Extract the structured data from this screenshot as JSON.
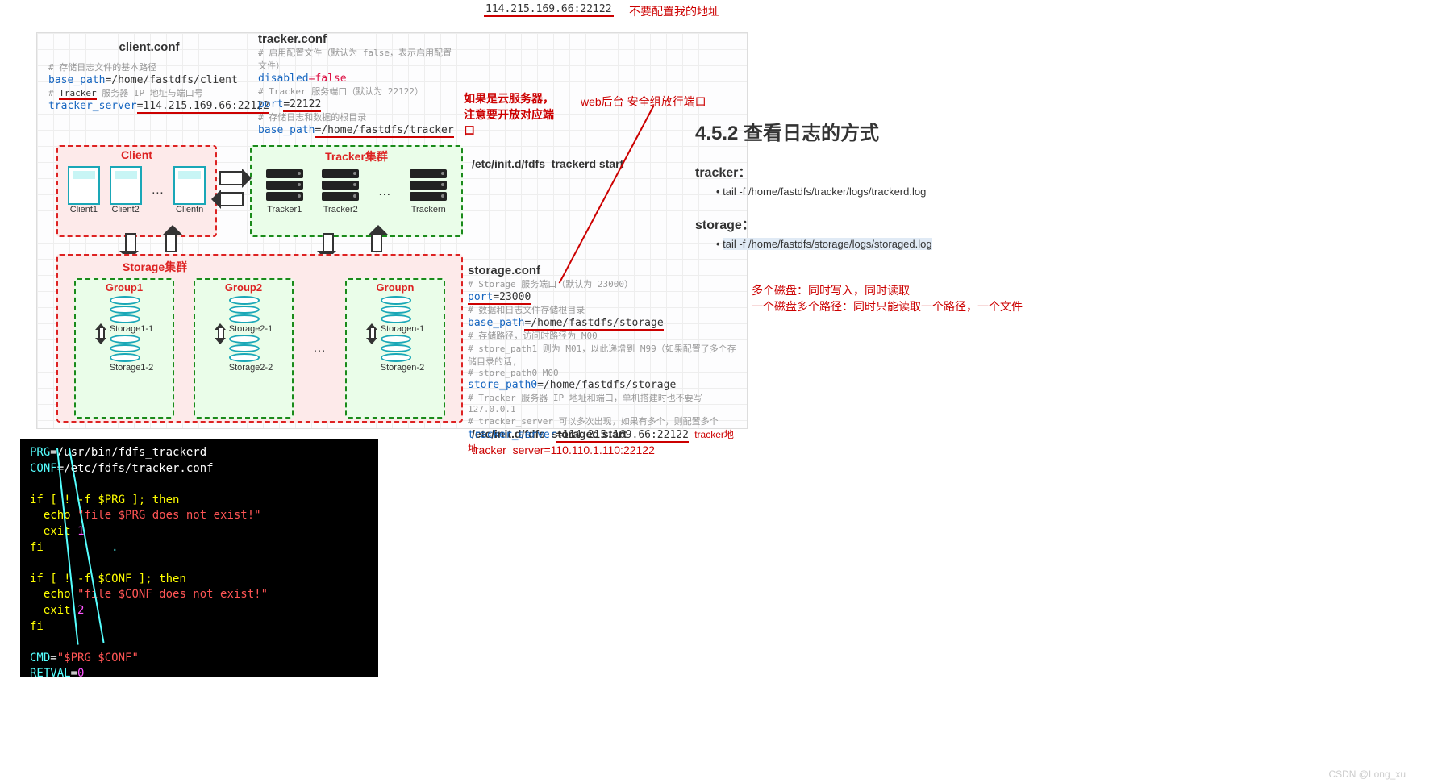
{
  "top": {
    "address": "114.215.169.66:22122",
    "note": "不要配置我的地址"
  },
  "client_conf": {
    "title": "client.conf",
    "c1": "# 存储日志文件的基本路径",
    "l1k": "base_path",
    "l1v": "=/home/fastdfs/client",
    "c2": "# Tracker 服务器 IP 地址与端口号",
    "l2k": "tracker_server",
    "l2v": "=114.215.169.66:22122"
  },
  "tracker_conf": {
    "title": "tracker.conf",
    "c1": "# 启用配置文件（默认为 false，表示启用配置文件）",
    "l1k": "disabled",
    "l1v": "=false",
    "c2": "# Tracker 服务端口（默认为 22122）",
    "l2k": "port",
    "l2v": "=22122",
    "c3": "# 存储日志和数据的根目录",
    "l3k": "base_path",
    "l3v": "=/home/fastdfs/tracker"
  },
  "red_notes": {
    "cloud": "如果是云服务器，注意要开放对应端口",
    "web": "web后台 安全组放行端口"
  },
  "boxes": {
    "client_label": "Client",
    "clients": [
      "Client1",
      "Client2",
      "Clientn"
    ],
    "tracker_label": "Tracker集群",
    "trackers": [
      "Tracker1",
      "Tracker2",
      "Trackern"
    ],
    "storage_label": "Storage集群",
    "groups": [
      {
        "name": "Group1",
        "sub": [
          "Storage1-1",
          "Storage1-2"
        ],
        "sync": "同步"
      },
      {
        "name": "Group2",
        "sub": [
          "Storage2-1",
          "Storage2-2"
        ],
        "sync": "同步"
      },
      {
        "name": "Groupn",
        "sub": [
          "Storagen-1",
          "Storagen-2"
        ],
        "sync": "同步"
      }
    ]
  },
  "init_cmds": {
    "trackerd": "/etc/init.d/fdfs_trackerd start",
    "storaged": "/etc/init.d/fdfs_storaged start"
  },
  "storage_conf": {
    "title": "storage.conf",
    "c1": "# Storage 服务端口（默认为 23000）",
    "l1k": "port",
    "l1v": "=23000",
    "c2": "# 数据和日志文件存储根目录",
    "l2k": "base_path",
    "l2v": "=/home/fastdfs/storage",
    "c3": "# 存储路径，访问时路径为 M00",
    "c4": "# store_path1 则为 M01，以此递增到 M99（如果配置了多个存储目录的话,",
    "c5": "# store_path0 M00",
    "l3k": "store_path0",
    "l3v": "=/home/fastdfs/storage",
    "c6": "# Tracker 服务器 IP 地址和端口，单机搭建时也不要写 127.0.0.1",
    "c7": "# tracker_server 可以多次出现，如果有多个，则配置多个",
    "l4k": "tracker_server",
    "l4v": "=114.215.169.66:22122",
    "tracker_addr_note": "tracker地址",
    "alt_tracker": "tracker_server=110.110.1.110:22122"
  },
  "right": {
    "h2": "4.5.2 查看日志的方式",
    "tracker_h": "tracker：",
    "tracker_cmd": "tail -f /home/fastdfs/tracker/logs/trackerd.log",
    "storage_h": "storage：",
    "storage_cmd": "tail -f /home/fastdfs/storage/logs/storaged.log",
    "disk1": "多个磁盘：同时写入，同时读取",
    "disk2": "一个磁盘多个路径：同时只能读取一个路径，一个文件"
  },
  "terminal": {
    "l1a": "PRG",
    "l1b": "=/usr/bin/fdfs_trackerd",
    "l2a": "CONF",
    "l2b": "=/etc/fdfs/tracker.conf",
    "l3": "if [ ! -f $PRG ]; then",
    "l4a": "  echo ",
    "l4b": "\"file $PRG does not exist!\"",
    "l5a": "  exit ",
    "l5b": "1",
    "l6": "fi",
    "l6dot": ".",
    "l7": "if [ ! -f $CONF ]; then",
    "l8a": "  echo ",
    "l8b": "\"file $CONF does not exist!\"",
    "l9a": "  exit ",
    "l9b": "2",
    "l10": "fi",
    "l11a": "CMD",
    "l11b": "=",
    "l11c": "\"$PRG $CONF\"",
    "l12a": "RETVAL",
    "l12b": "=",
    "l12c": "0"
  },
  "watermark": "CSDN @Long_xu"
}
